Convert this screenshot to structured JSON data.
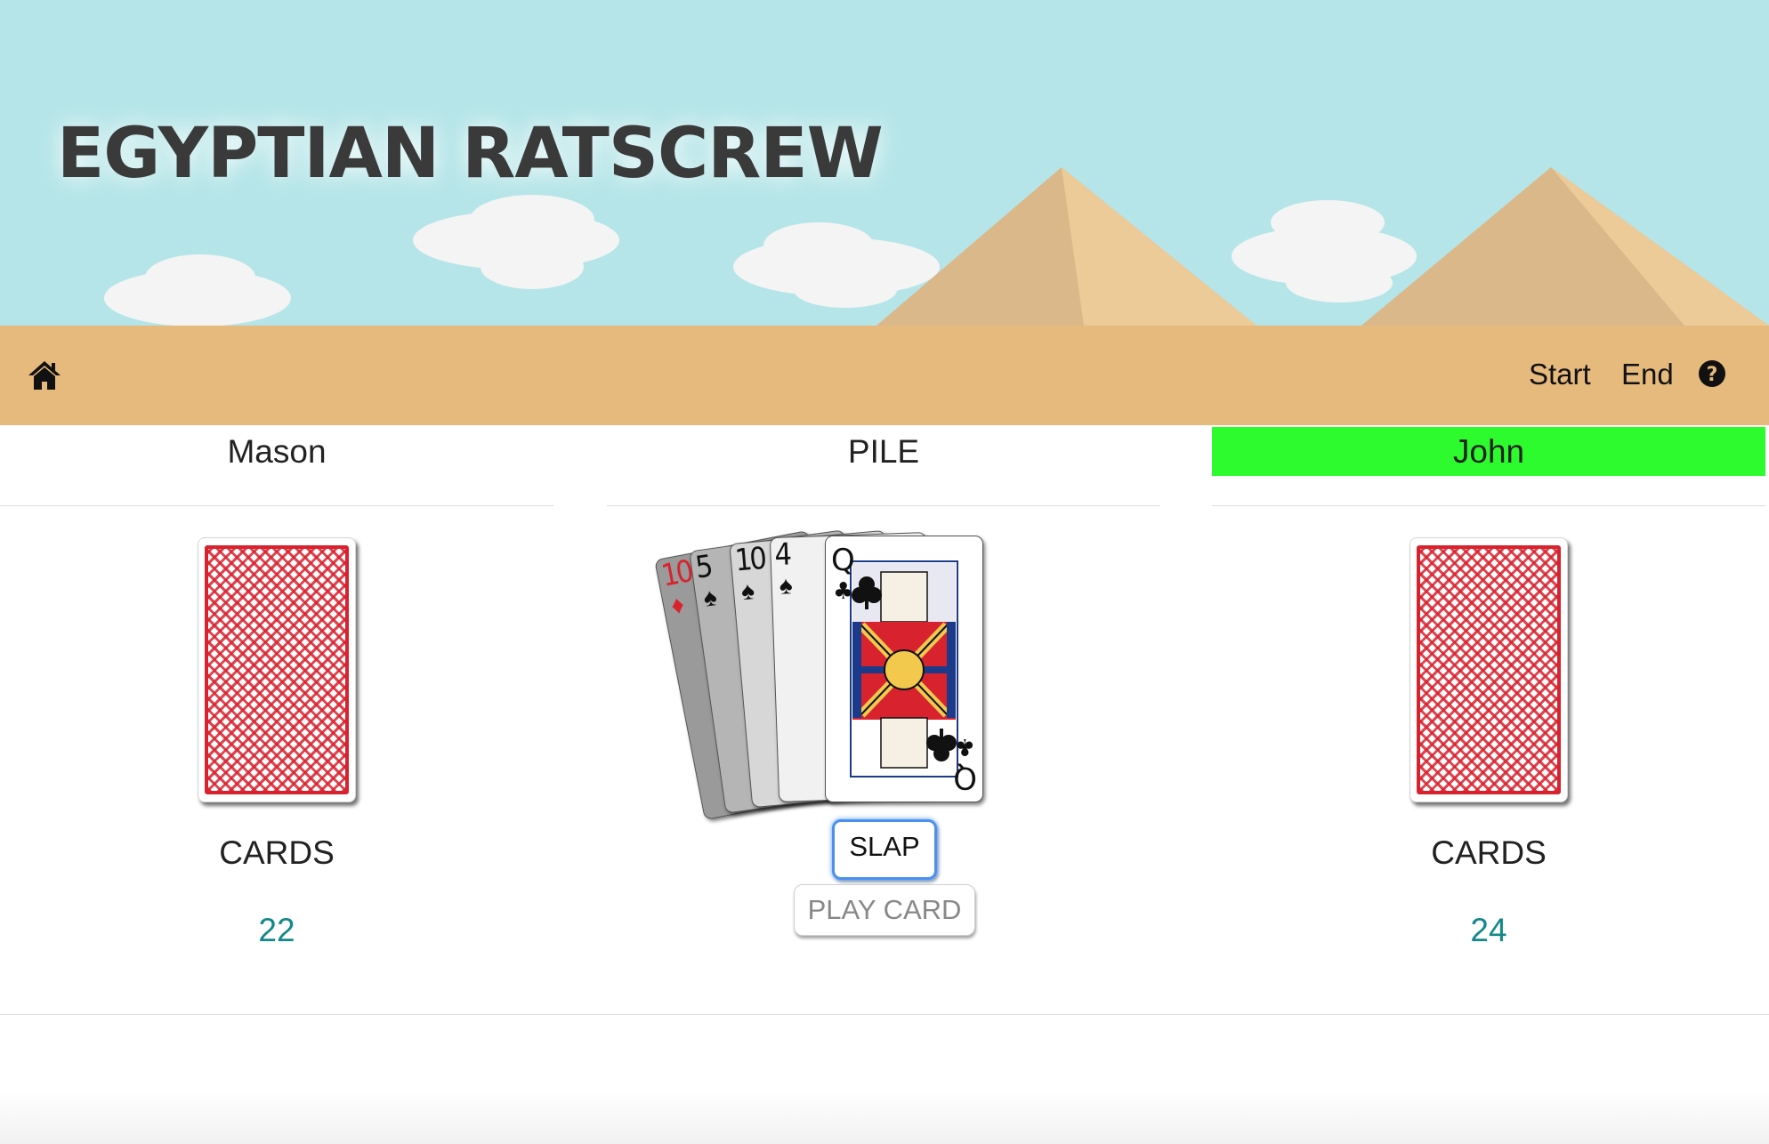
{
  "header": {
    "title": "EGYPTIAN RATSCREW"
  },
  "nav": {
    "home_icon": "home-icon",
    "start_label": "Start",
    "end_label": "End",
    "help_icon": "question-circle-icon"
  },
  "players": {
    "left": {
      "name": "Mason",
      "cards_label": "CARDS",
      "card_count": "22"
    },
    "right": {
      "name": "John",
      "cards_label": "CARDS",
      "card_count": "24",
      "active": true
    }
  },
  "pile": {
    "label": "PILE",
    "cards": [
      {
        "rank": "10",
        "suit": "♦",
        "color": "#d8232f"
      },
      {
        "rank": "5",
        "suit": "♠",
        "color": "#111111"
      },
      {
        "rank": "10",
        "suit": "♠",
        "color": "#111111"
      },
      {
        "rank": "4",
        "suit": "♠",
        "color": "#111111"
      },
      {
        "rank": "Q",
        "suit": "♣",
        "color": "#111111"
      }
    ],
    "slap_label": "SLAP",
    "play_card_label": "PLAY CARD"
  },
  "colors": {
    "sky": "#b5e5e8",
    "sand": "#e6b97c",
    "active_player": "#2dfb2d",
    "count_text": "#13888a",
    "card_back": "#d8232f"
  }
}
